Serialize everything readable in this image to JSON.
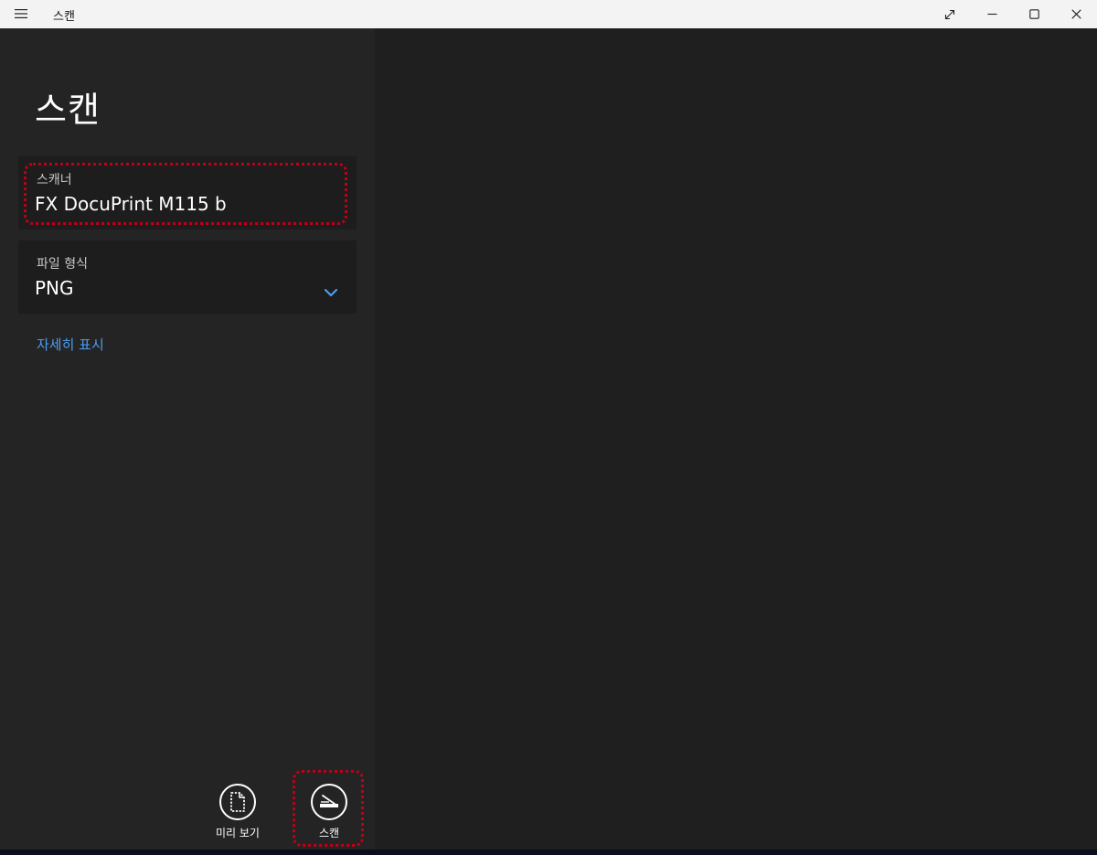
{
  "titlebar": {
    "app_title": "스캔",
    "menu_icon": "hamburger-menu-icon",
    "fullscreen_icon": "expand-diagonal-icon",
    "minimize_icon": "minimize-icon",
    "maximize_icon": "maximize-icon",
    "close_icon": "close-icon"
  },
  "left": {
    "page_title": "스캔",
    "scanner": {
      "label": "스캐너",
      "value": "FX DocuPrint M115 b"
    },
    "file_format": {
      "label": "파일 형식",
      "value": "PNG",
      "icon": "chevron-down-icon"
    },
    "more_link": "자세히 표시"
  },
  "actions": {
    "preview": {
      "label": "미리 보기",
      "icon": "document-preview-icon"
    },
    "scan": {
      "label": "스캔",
      "icon": "scanner-icon"
    }
  },
  "colors": {
    "accent": "#4c9bf0",
    "highlight": "#c00018",
    "panel_bg": "#242424",
    "field_bg": "#1d1d1d",
    "content_bg": "#1f1f1f"
  }
}
